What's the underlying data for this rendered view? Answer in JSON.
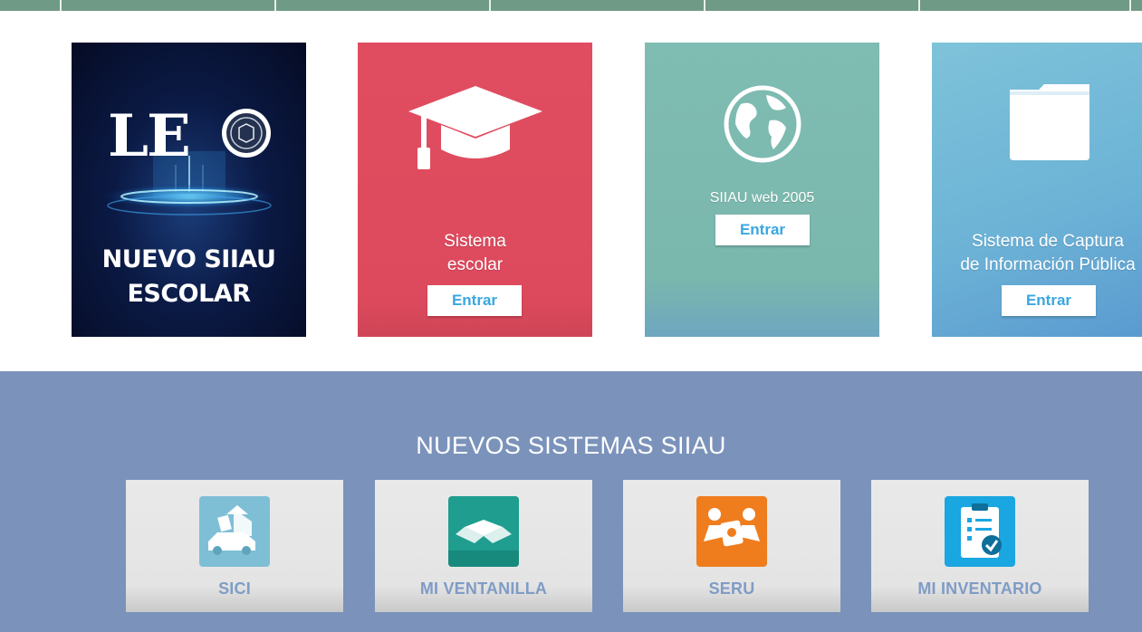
{
  "cards": {
    "leo": {
      "title_line1": "NUEVO SIIAU",
      "title_line2": "ESCOLAR"
    },
    "escolar": {
      "label_line1": "Sistema",
      "label_line2": "escolar",
      "button": "Entrar",
      "color": "#e04d60"
    },
    "siiau": {
      "label": "SIIAU web 2005",
      "button": "Entrar",
      "color": "#7fbcb2"
    },
    "captura": {
      "label_line1": "Sistema de Captura",
      "label_line2": "de Información Pública",
      "button": "Entrar",
      "color": "#6cb2d6"
    }
  },
  "nuevos": {
    "title": "NUEVOS SISTEMAS SIIAU",
    "items": [
      {
        "label": "SICI",
        "icon": "house-car-icon",
        "icon_color": "#7fbfd6"
      },
      {
        "label": "MI VENTANILLA",
        "icon": "open-box-icon",
        "icon_color": "#1f9d8e"
      },
      {
        "label": "SERU",
        "icon": "handshake-badge-icon",
        "icon_color": "#ef7d1e"
      },
      {
        "label": "MI INVENTARIO",
        "icon": "clipboard-check-icon",
        "icon_color": "#1aa6e0"
      }
    ],
    "background": "#7b93bb"
  }
}
